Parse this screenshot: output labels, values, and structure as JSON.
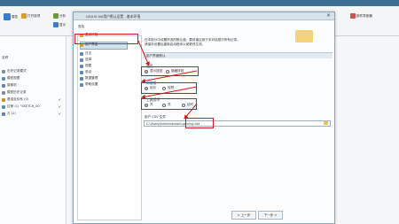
{
  "ribbon": {
    "buttons": [
      {
        "label": "属性",
        "name": "properties-button",
        "color": "#3a7bd5"
      },
      {
        "label": "打开选项",
        "name": "open-options-button",
        "color": "#e39a2d"
      },
      {
        "label": "分析",
        "name": "analysis-button",
        "color": "#6b9a3a"
      },
      {
        "label": "显示",
        "name": "display-button",
        "color": "#3a7bd5"
      },
      {
        "label": "曲面分析",
        "name": "surface-analysis-button",
        "color": "#7b5bc4"
      },
      {
        "label": "装配导航",
        "name": "assembly-nav-button",
        "color": "#3a7bd5"
      },
      {
        "label": "部件导航器",
        "name": "part-navigator-button",
        "color": "#d35050"
      }
    ]
  },
  "left_panel": {
    "rows": [
      {
        "label": "名称",
        "tick": false
      },
      {
        "label": "历史记录模式",
        "tick": false
      },
      {
        "label": "模型视图",
        "tick": false
      },
      {
        "label": "摄像机",
        "tick": false
      },
      {
        "label": "模型历史记录",
        "tick": false
      },
      {
        "label": "基准坐标系 (0)",
        "tick": true
      },
      {
        "label": "拉伸 (1) \"SKETCH_00",
        "tick": true
      },
      {
        "label": "孔 (2)",
        "tick": true
      }
    ]
  },
  "dialog": {
    "title": "UG/UG NX用户默认设置 - 基本环境",
    "search_label": "查找",
    "nav_items": [
      {
        "label": "基本环境",
        "selected": false
      },
      {
        "label": "用户界面",
        "selected": true
      },
      {
        "label": "日志",
        "selected": false
      },
      {
        "label": "选择",
        "selected": false
      },
      {
        "label": "视图",
        "selected": false
      },
      {
        "label": "验证",
        "selected": false
      },
      {
        "label": "数据管理",
        "selected": false
      },
      {
        "label": "帮助设置",
        "selected": false
      }
    ],
    "description_line1": "在本部分中设置所选的默认值，要将值应用于本对话框中所有记录，",
    "description_line2": "请保存设置后重新启动程序以使更改生效。",
    "tab_label": "用户界面默认",
    "group1": {
      "header": "通用",
      "options": [
        "显示按钮",
        "隐藏按钮"
      ]
    },
    "group2": {
      "header": "对话框",
      "options": [
        "较长",
        "较短"
      ]
    },
    "group3": {
      "header": "工具提示",
      "options": [
        "开",
        "关",
        "延时"
      ]
    },
    "path_label": "用户 CSV 文件",
    "path_value": "C:\\Users\\Administrator\\ugnx\\ug.dat",
    "back_button": "< 上一步",
    "next_button": "下一步 >"
  }
}
